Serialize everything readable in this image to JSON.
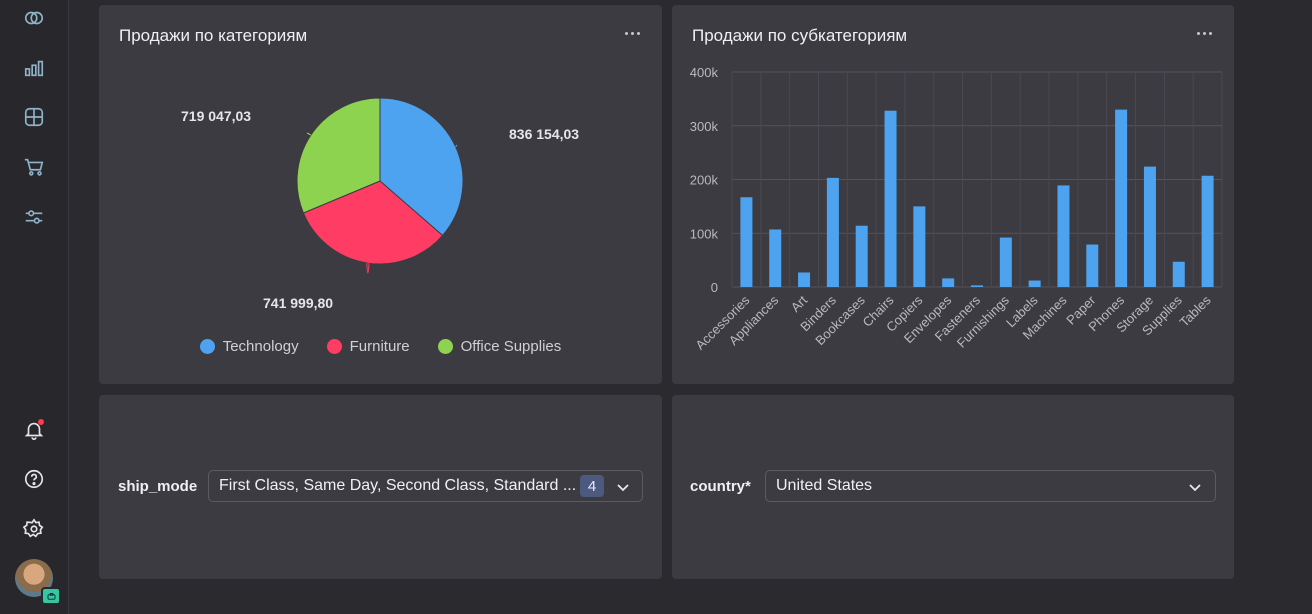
{
  "sidebar": {
    "icons": [
      "collections-icon",
      "chart-icon",
      "dashboard-icon",
      "cart-icon",
      "settings-sliders-icon"
    ],
    "bottom_icons": [
      "notifications-icon",
      "help-icon",
      "settings-icon"
    ]
  },
  "colors": {
    "technology": "#4da3f0",
    "furniture": "#ff3d64",
    "office_supplies": "#8ed34f",
    "bar": "#4da3f0"
  },
  "pie_panel": {
    "title": "Продажи по категориям",
    "chart_data": {
      "type": "pie",
      "title": "Продажи по категориям",
      "slices": [
        {
          "name": "Technology",
          "value": 836154.03,
          "label": "836 154,03"
        },
        {
          "name": "Furniture",
          "value": 741999.8,
          "label": "741 999,80"
        },
        {
          "name": "Office Supplies",
          "value": 719047.03,
          "label": "719 047,03"
        }
      ],
      "legend_placement": "bottom"
    },
    "legend": [
      "Technology",
      "Furniture",
      "Office Supplies"
    ]
  },
  "bar_panel": {
    "title": "Продажи по субкатегориям",
    "chart_data": {
      "type": "bar",
      "title": "Продажи по субкатегориям",
      "categories": [
        "Accessories",
        "Appliances",
        "Art",
        "Binders",
        "Bookcases",
        "Chairs",
        "Copiers",
        "Envelopes",
        "Fasteners",
        "Furnishings",
        "Labels",
        "Machines",
        "Paper",
        "Phones",
        "Storage",
        "Supplies",
        "Tables"
      ],
      "values": [
        167000,
        107000,
        27000,
        203000,
        114000,
        328000,
        150000,
        16000,
        3000,
        92000,
        12000,
        189000,
        79000,
        330000,
        224000,
        47000,
        207000
      ],
      "ylim": [
        0,
        400000
      ],
      "yticks": [
        "400k",
        "300k",
        "200k",
        "100k",
        "0"
      ],
      "grid": true
    }
  },
  "filters": {
    "ship_mode": {
      "label": "ship_mode",
      "value": "First Class, Same Day, Second Class, Standard ...",
      "count": "4"
    },
    "country": {
      "label": "country*",
      "value": "United States"
    }
  }
}
